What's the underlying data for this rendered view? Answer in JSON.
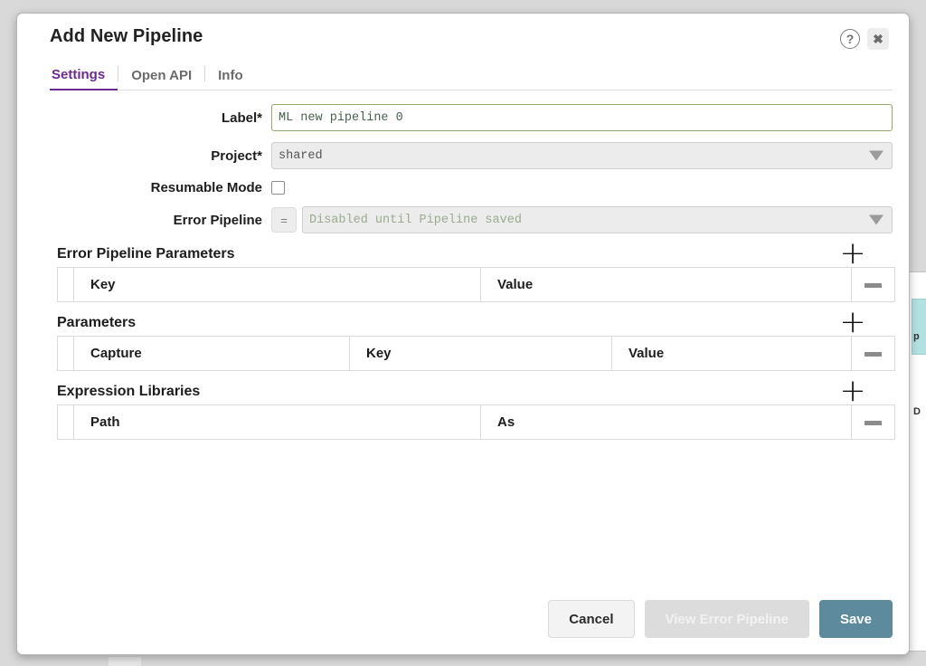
{
  "modal": {
    "title": "Add New Pipeline",
    "help_icon": "help-circle-icon",
    "close_icon": "close-icon",
    "help_glyph": "?",
    "close_glyph": "✖"
  },
  "tabs": [
    {
      "label": "Settings",
      "active": true
    },
    {
      "label": "Open API",
      "active": false
    },
    {
      "label": "Info",
      "active": false
    }
  ],
  "form": {
    "label_field": {
      "label": "Label*",
      "value": "ML new pipeline 0",
      "placeholder": ""
    },
    "project_field": {
      "label": "Project*",
      "value": "shared"
    },
    "resumable_mode": {
      "label": "Resumable Mode",
      "checked": false
    },
    "error_pipeline": {
      "label": "Error Pipeline",
      "expression_toggle": "=",
      "value": "Disabled until Pipeline saved",
      "disabled": true
    }
  },
  "sections": [
    {
      "title": "Error Pipeline Parameters",
      "add_label": "+",
      "remove_label": "–",
      "columns": [
        "Key",
        "Value"
      ],
      "col_widths": [
        "450px",
        "410px"
      ],
      "rows": []
    },
    {
      "title": "Parameters",
      "add_label": "+",
      "remove_label": "–",
      "columns": [
        "Capture",
        "Key",
        "Value"
      ],
      "col_widths": [
        "305px",
        "290px",
        "265px"
      ],
      "rows": []
    },
    {
      "title": "Expression Libraries",
      "add_label": "+",
      "remove_label": "–",
      "columns": [
        "Path",
        "As"
      ],
      "col_widths": [
        "450px",
        "410px"
      ],
      "rows": []
    }
  ],
  "footer": {
    "cancel_label": "Cancel",
    "view_error_pipeline_label": "View Error Pipeline",
    "save_label": "Save"
  },
  "background": {
    "fragment_one": "p",
    "fragment_two": "D"
  },
  "colors": {
    "accent_purple": "#6a2b8f",
    "save_blue": "#5d8a9c",
    "input_green_border": "#93a86f",
    "input_green_text": "#4a6150",
    "backdrop_gray": "#d9d9d9"
  }
}
